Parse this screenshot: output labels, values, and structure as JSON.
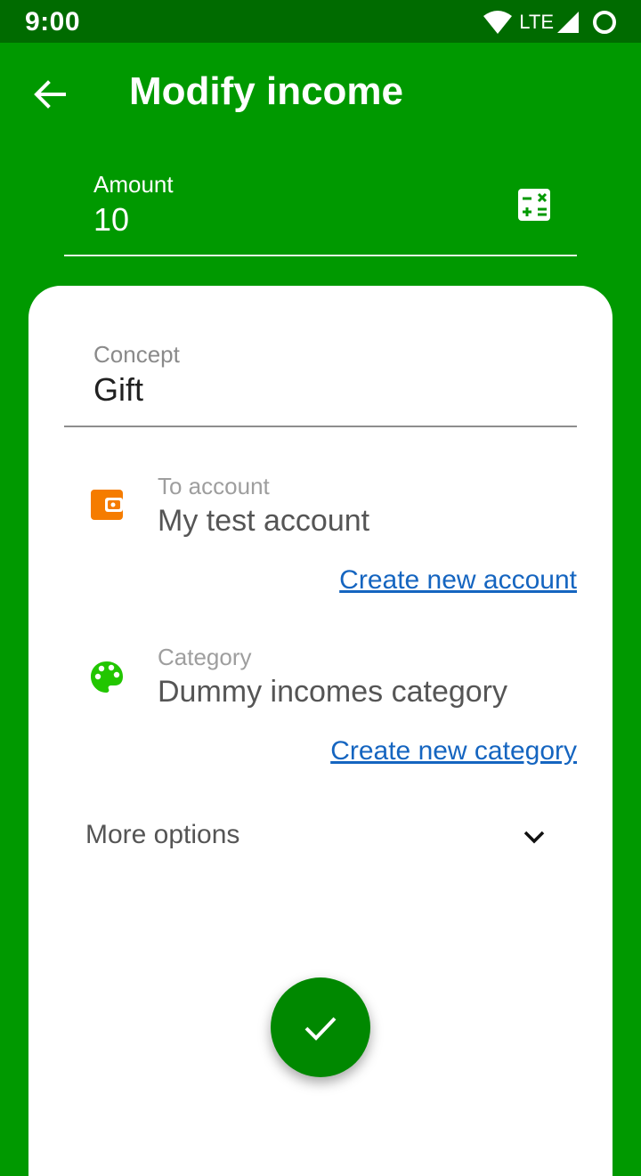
{
  "status_bar": {
    "time": "9:00",
    "network": "LTE"
  },
  "toolbar": {
    "title": "Modify income",
    "back_icon": "arrow-back-icon"
  },
  "amount": {
    "label": "Amount",
    "value": "10",
    "calculator_icon": "calculator-icon"
  },
  "form": {
    "concept": {
      "label": "Concept",
      "value": "Gift"
    },
    "account": {
      "label": "To account",
      "value": "My test account",
      "icon": "wallet-icon",
      "icon_color": "#f57c00",
      "create_link": "Create new account"
    },
    "category": {
      "label": "Category",
      "value": "Dummy incomes category",
      "icon": "palette-icon",
      "icon_color": "#22c600",
      "create_link": "Create new category"
    },
    "more_options": {
      "label": "More options",
      "icon": "chevron-down-icon"
    }
  },
  "fab": {
    "icon": "check-icon"
  },
  "colors": {
    "primary": "#009900",
    "primary_dark": "#006b00",
    "fab": "#008800",
    "link": "#1565c0"
  }
}
